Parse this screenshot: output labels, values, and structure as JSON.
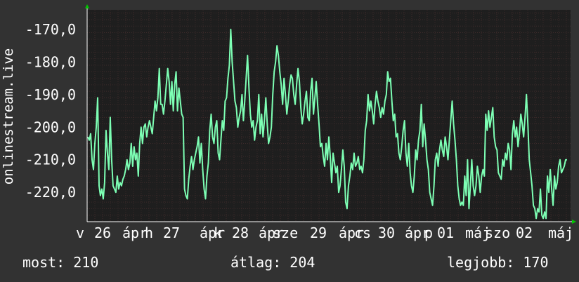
{
  "colors": {
    "background": "#323232",
    "plot_background": "#1e1e1e",
    "grid": "#3c2a2a",
    "line": "#7dffb4",
    "axis_arrow": "#00c800",
    "text": "#ffffff"
  },
  "footer": {
    "most": "most: 210",
    "atlag": "átlag: 204",
    "legjobb": "legjobb: 170"
  },
  "chart_data": {
    "type": "line",
    "ylabel": "onlinestream.live",
    "ylim": [
      -229,
      -164
    ],
    "yticks": [
      -170,
      -180,
      -190,
      -200,
      -210,
      -220
    ],
    "ytick_labels": [
      "-170,0",
      "-180,0",
      "-190,0",
      "-200,0",
      "-210,0",
      "-220,0"
    ],
    "x_range": [
      0,
      688
    ],
    "xtick_positions": [
      22,
      66,
      102,
      156,
      199,
      246,
      283,
      336,
      376,
      422,
      462,
      518,
      556,
      610,
      644
    ],
    "xtick_labels": [
      "v",
      "26",
      "ápr",
      "h",
      "27",
      "ápr",
      "k",
      "28",
      "ápr",
      "sze",
      "29",
      "ápr",
      "cs",
      "30",
      "ápr",
      "p",
      "01",
      "máj",
      "szo",
      "02",
      "máj"
    ],
    "grid": true,
    "series": [
      {
        "values": [
          -203,
          -204,
          -202,
          -210,
          -213,
          -205,
          -200,
          -191,
          -218,
          -221,
          -219,
          -222,
          -217,
          -201,
          -208,
          -213,
          -197,
          -210,
          -218,
          -219,
          -220,
          -215,
          -219,
          -217,
          -218,
          -216,
          -215,
          -213,
          -210,
          -213,
          -211,
          -205,
          -212,
          -206,
          -210,
          -208,
          -215,
          -205,
          -200,
          -205,
          -200,
          -199,
          -203,
          -200,
          -198,
          -200,
          -202,
          -197,
          -192,
          -195,
          -191,
          -182,
          -193,
          -193,
          -196,
          -192,
          -187,
          -182,
          -186,
          -193,
          -186,
          -195,
          -187,
          -183,
          -195,
          -188,
          -192,
          -196,
          -197,
          -219,
          -221,
          -222,
          -216,
          -212,
          -209,
          -213,
          -210,
          -208,
          -206,
          -203,
          -211,
          -205,
          -213,
          -219,
          -222,
          -215,
          -211,
          -201,
          -196,
          -203,
          -205,
          -200,
          -198,
          -208,
          -210,
          -204,
          -198,
          -201,
          -192,
          -191,
          -185,
          -181,
          -170,
          -180,
          -186,
          -192,
          -194,
          -200,
          -197,
          -195,
          -190,
          -198,
          -192,
          -185,
          -178,
          -188,
          -196,
          -200,
          -198,
          -204,
          -200,
          -198,
          -190,
          -202,
          -196,
          -203,
          -198,
          -191,
          -199,
          -205,
          -203,
          -200,
          -190,
          -183,
          -180,
          -175,
          -178,
          -183,
          -187,
          -193,
          -185,
          -190,
          -196,
          -192,
          -187,
          -184,
          -185,
          -190,
          -193,
          -187,
          -182,
          -186,
          -194,
          -199,
          -196,
          -192,
          -189,
          -197,
          -198,
          -189,
          -185,
          -196,
          -191,
          -186,
          -193,
          -199,
          -206,
          -205,
          -209,
          -212,
          -205,
          -210,
          -203,
          -209,
          -217,
          -208,
          -211,
          -214,
          -212,
          -220,
          -218,
          -213,
          -207,
          -212,
          -223,
          -225,
          -218,
          -215,
          -211,
          -213,
          -208,
          -212,
          -211,
          -209,
          -213,
          -212,
          -214,
          -210,
          -201,
          -198,
          -190,
          -195,
          -192,
          -195,
          -199,
          -193,
          -189,
          -192,
          -194,
          -197,
          -194,
          -196,
          -192,
          -190,
          -183,
          -186,
          -185,
          -192,
          -198,
          -196,
          -203,
          -202,
          -208,
          -210,
          -206,
          -201,
          -198,
          -208,
          -212,
          -205,
          -214,
          -218,
          -220,
          -215,
          -207,
          -210,
          -204,
          -201,
          -193,
          -206,
          -199,
          -204,
          -210,
          -213,
          -220,
          -222,
          -224,
          -218,
          -210,
          -208,
          -212,
          -207,
          -204,
          -207,
          -209,
          -203,
          -206,
          -210,
          -204,
          -198,
          -192,
          -199,
          -204,
          -210,
          -218,
          -222,
          -224,
          -223,
          -224,
          -215,
          -221,
          -210,
          -225,
          -218,
          -210,
          -218,
          -221,
          -218,
          -212,
          -215,
          -220,
          -215,
          -213,
          -215,
          -196,
          -201,
          -195,
          -200,
          -197,
          -194,
          -203,
          -206,
          -207,
          -214,
          -215,
          -216,
          -210,
          -212,
          -208,
          -210,
          -205,
          -207,
          -213,
          -202,
          -198,
          -203,
          -200,
          -206,
          -202,
          -196,
          -199,
          -203,
          -197,
          -190,
          -199,
          -210,
          -214,
          -218,
          -224,
          -225,
          -228,
          -225,
          -226,
          -219,
          -227,
          -228,
          -226,
          -228,
          -215,
          -220,
          -213,
          -219,
          -224,
          -215,
          -219,
          -217,
          -212,
          -210,
          -214,
          -213,
          -212,
          -210,
          -210
        ]
      }
    ]
  }
}
